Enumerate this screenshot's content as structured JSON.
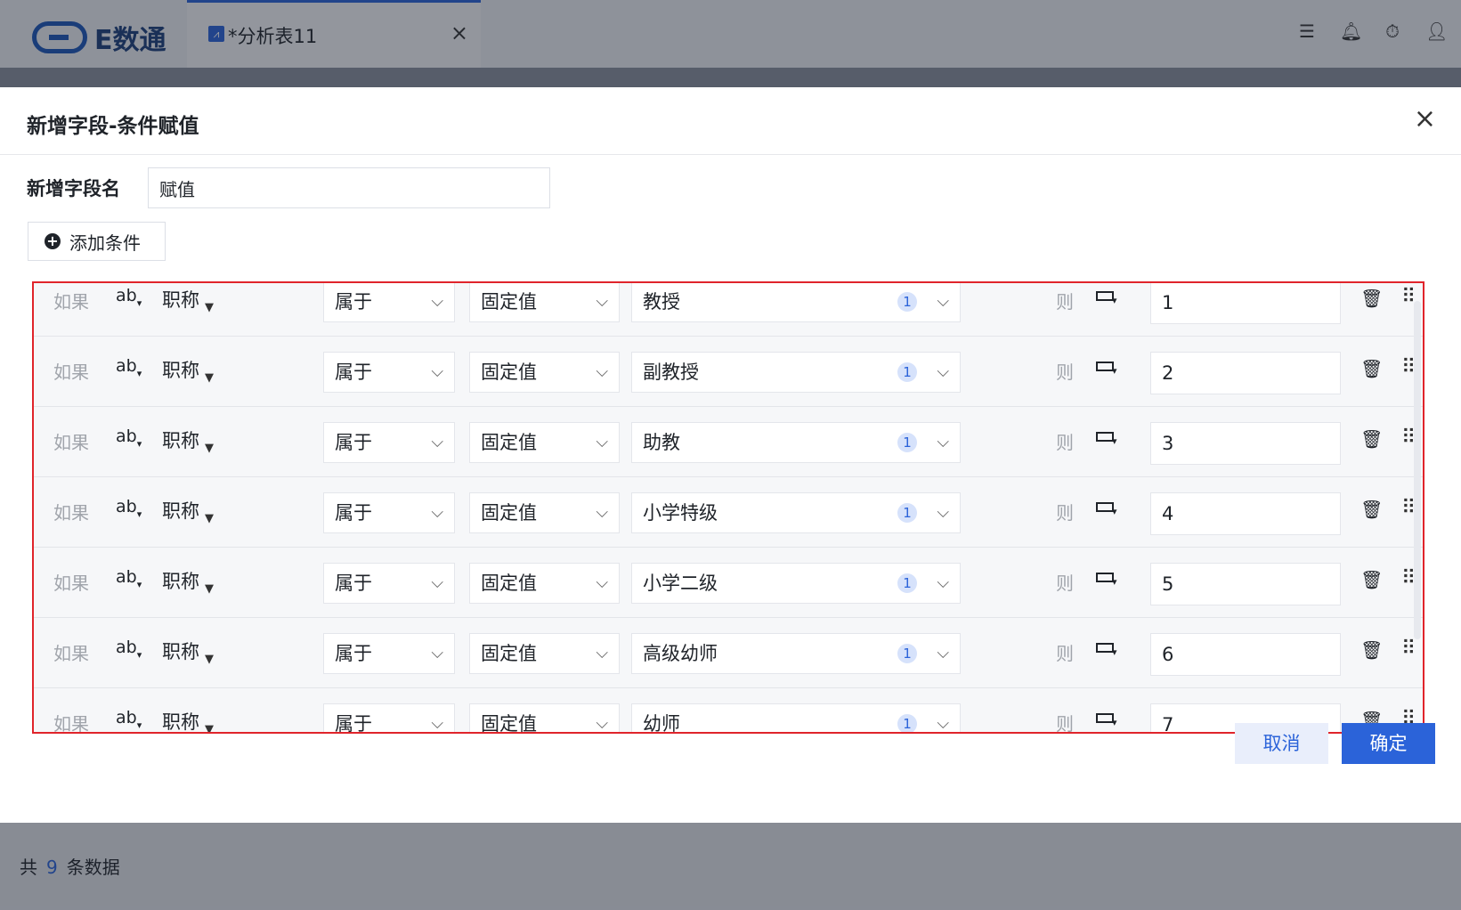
{
  "app": {
    "logo_text": "E数通",
    "tab_label": "*分析表11",
    "tab_close": "×",
    "top_icons": [
      "task-list-icon",
      "bell-icon",
      "timer-icon",
      "user-icon"
    ]
  },
  "background": {
    "footer_prefix": "共",
    "footer_count": "9",
    "footer_suffix": "条数据"
  },
  "modal": {
    "title": "新增字段-条件赋值",
    "close": "×",
    "field_name_label": "新增字段名",
    "field_name_value": "赋值",
    "add_condition_label": "添加条件",
    "cancel_label": "取消",
    "confirm_label": "确定"
  },
  "conditions": {
    "if_label": "如果",
    "type_label": "ab",
    "then_label": "则",
    "rows": [
      {
        "field": "职称",
        "operator": "属于",
        "value_type": "固定值",
        "value": "教授",
        "badge": "1",
        "result": "1"
      },
      {
        "field": "职称",
        "operator": "属于",
        "value_type": "固定值",
        "value": "副教授",
        "badge": "1",
        "result": "2"
      },
      {
        "field": "职称",
        "operator": "属于",
        "value_type": "固定值",
        "value": "助教",
        "badge": "1",
        "result": "3"
      },
      {
        "field": "职称",
        "operator": "属于",
        "value_type": "固定值",
        "value": "小学特级",
        "badge": "1",
        "result": "4"
      },
      {
        "field": "职称",
        "operator": "属于",
        "value_type": "固定值",
        "value": "小学二级",
        "badge": "1",
        "result": "5"
      },
      {
        "field": "职称",
        "operator": "属于",
        "value_type": "固定值",
        "value": "高级幼师",
        "badge": "1",
        "result": "6"
      },
      {
        "field": "职称",
        "operator": "属于",
        "value_type": "固定值",
        "value": "幼师",
        "badge": "1",
        "result": "7"
      }
    ]
  },
  "colors": {
    "primary": "#2b63d9",
    "highlight_border": "#e0242b"
  }
}
